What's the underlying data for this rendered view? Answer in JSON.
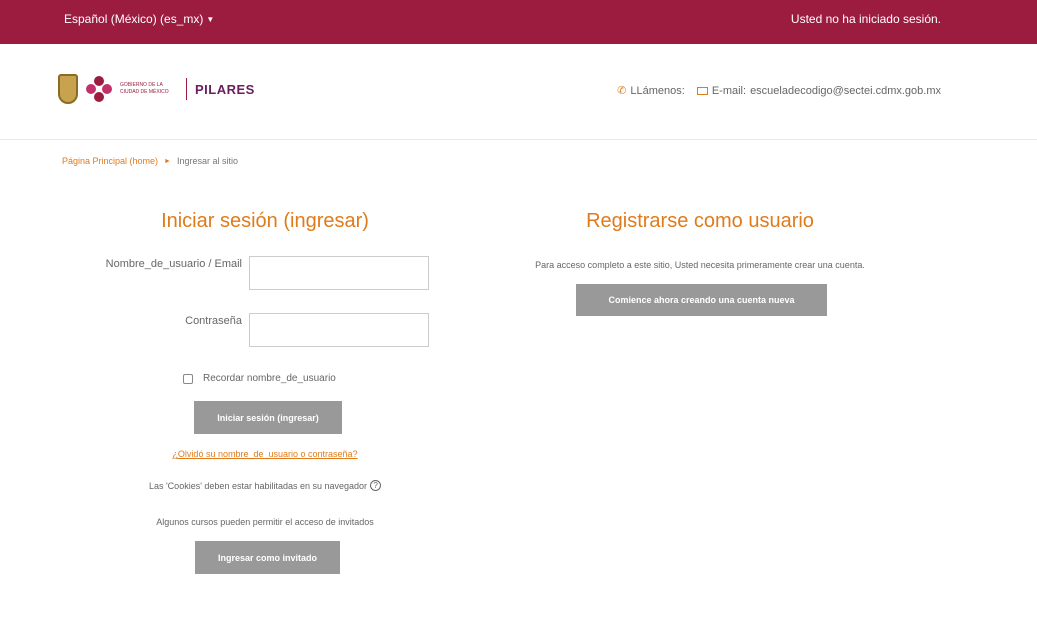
{
  "topbar": {
    "language": "Español (México) (es_mx)",
    "login_status": "Usted no ha iniciado sesión."
  },
  "header": {
    "logo_gov_text": "Gobierno de la Ciudad de México",
    "logo_brand": "PILARES",
    "call_label": "LLámenos:",
    "email_label": "E-mail:",
    "email": "escueladecodigo@sectei.cdmx.gob.mx"
  },
  "breadcrumb": {
    "home": "Página Principal (home)",
    "current": "Ingresar al sitio"
  },
  "login": {
    "title": "Iniciar sesión (ingresar)",
    "username_label": "Nombre_de_usuario / Email",
    "username_value": "",
    "password_label": "Contraseña",
    "password_value": "",
    "remember_label": "Recordar nombre_de_usuario",
    "submit_label": "Iniciar sesión (ingresar)",
    "forgot_link": "¿Olvidó su nombre_de_usuario o contraseña?",
    "cookies_notice": "Las 'Cookies' deben estar habilitadas en su navegador",
    "help_glyph": "?",
    "guest_notice": "Algunos cursos pueden permitir el acceso de invitados",
    "guest_button": "Ingresar como invitado"
  },
  "signup": {
    "title": "Registrarse como usuario",
    "text": "Para acceso completo a este sitio, Usted necesita primeramente crear una cuenta.",
    "button": "Comience ahora creando una cuenta nueva"
  },
  "colors": {
    "topbar": "#9c1c40",
    "accent": "#e07b1c",
    "button": "#999999"
  }
}
